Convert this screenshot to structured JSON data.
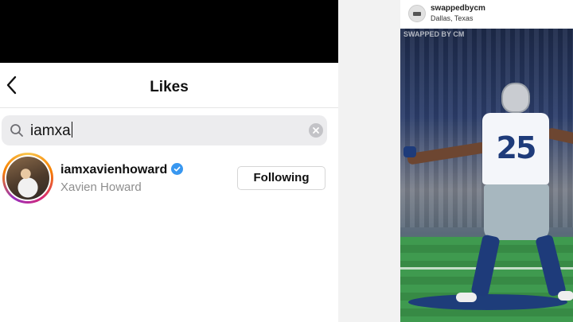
{
  "likes_screen": {
    "title": "Likes",
    "search": {
      "value": "iamxa"
    },
    "results": [
      {
        "username": "iamxavienhoward",
        "full_name": "Xavien Howard",
        "verified": true,
        "follow_label": "Following"
      }
    ]
  },
  "post": {
    "username": "swappedbycm",
    "location": "Dallas, Texas",
    "watermark": "SWAPPED BY CM",
    "jersey_number": "25"
  },
  "colors": {
    "verified_blue": "#3897f0",
    "text_primary": "#111111",
    "text_secondary": "#8e8e8e"
  }
}
